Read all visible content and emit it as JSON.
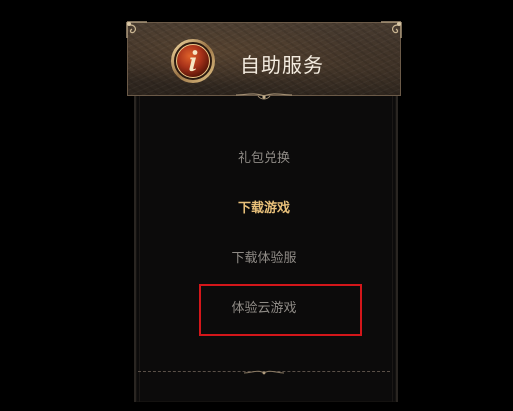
{
  "panel": {
    "title": "自助服务",
    "icon": "info-icon"
  },
  "menu": {
    "items": [
      {
        "label": "礼包兑换",
        "active": false
      },
      {
        "label": "下载游戏",
        "active": true
      },
      {
        "label": "下载体验服",
        "active": false
      },
      {
        "label": "体验云游戏",
        "active": false
      }
    ]
  },
  "colors": {
    "background": "#000000",
    "header_title": "#f4ece0",
    "menu_text": "#8f8b86",
    "menu_active": "#e8c07a",
    "highlight": "#d4161a"
  }
}
